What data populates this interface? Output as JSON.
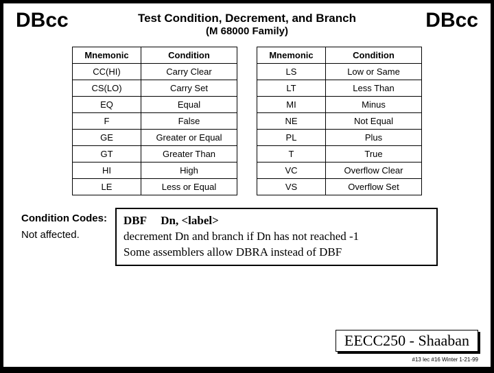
{
  "header": {
    "left_mnemonic": "DBcc",
    "title": "Test Condition, Decrement, and Branch",
    "subtitle": "(M 68000 Family)",
    "right_mnemonic": "DBcc"
  },
  "table_headers": {
    "mnemonic": "Mnemonic",
    "condition": "Condition"
  },
  "left_table": [
    {
      "m": "CC(HI)",
      "c": "Carry Clear"
    },
    {
      "m": "CS(LO)",
      "c": "Carry Set"
    },
    {
      "m": "EQ",
      "c": "Equal"
    },
    {
      "m": "F",
      "c": "False"
    },
    {
      "m": "GE",
      "c": "Greater or Equal"
    },
    {
      "m": "GT",
      "c": "Greater Than"
    },
    {
      "m": "HI",
      "c": "High"
    },
    {
      "m": "LE",
      "c": "Less or Equal"
    }
  ],
  "right_table": [
    {
      "m": "LS",
      "c": "Low or Same"
    },
    {
      "m": "LT",
      "c": "Less Than"
    },
    {
      "m": "MI",
      "c": "Minus"
    },
    {
      "m": "NE",
      "c": "Not Equal"
    },
    {
      "m": "PL",
      "c": "Plus"
    },
    {
      "m": "T",
      "c": "True"
    },
    {
      "m": "VC",
      "c": "Overflow Clear"
    },
    {
      "m": "VS",
      "c": "Overflow Set"
    }
  ],
  "cc": {
    "label": "Condition Codes:",
    "value": "Not affected."
  },
  "note": {
    "op": "DBF",
    "args": "Dn, <label>",
    "line2": "decrement Dn and branch if Dn has not reached -1",
    "line3": "Some assemblers allow DBRA instead of DBF"
  },
  "footer": "EECC250 - Shaaban",
  "tiny": "#13 lec #16 Winter 1-21-99"
}
